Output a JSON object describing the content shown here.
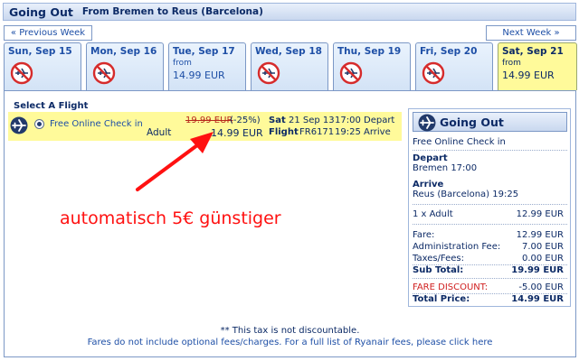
{
  "header": {
    "title": "Going Out",
    "route": "From Bremen to Reus (Barcelona)"
  },
  "nav": {
    "prev_week": "« Previous Week",
    "next_week": "Next Week »"
  },
  "days": [
    {
      "label": "Sun, Sep 15",
      "available": false,
      "from": "",
      "price": ""
    },
    {
      "label": "Mon, Sep 16",
      "available": false,
      "from": "",
      "price": ""
    },
    {
      "label": "Tue, Sep 17",
      "available": true,
      "from": "from",
      "price": "14.99 EUR"
    },
    {
      "label": "Wed, Sep 18",
      "available": false,
      "from": "",
      "price": ""
    },
    {
      "label": "Thu, Sep 19",
      "available": false,
      "from": "",
      "price": ""
    },
    {
      "label": "Fri, Sep 20",
      "available": false,
      "from": "",
      "price": ""
    },
    {
      "label": "Sat, Sep 21",
      "available": true,
      "selected": true,
      "from": "from",
      "price": "14.99 EUR"
    }
  ],
  "select_title": "Select A Flight",
  "flight": {
    "checkin": "Free Online Check in",
    "passenger": "Adult",
    "old_price": "19.99 EUR",
    "discount": "(-25%)",
    "new_price": "14.99 EUR",
    "day": "Sat",
    "date": "21 Sep 13",
    "depart_time": "17:00 Depart",
    "flight_label": "Flight",
    "flight_no": "FR6171",
    "arrive_time": "19:25 Arrive"
  },
  "annotation": "automatisch 5€ günstiger",
  "summary": {
    "title": "Going Out",
    "checkin": "Free Online Check in",
    "depart_label": "Depart",
    "depart_value": "Bremen 17:00",
    "arrive_label": "Arrive",
    "arrive_value": "Reus (Barcelona) 19:25",
    "passenger_line": {
      "label": "1 x Adult",
      "value": "12.99 EUR"
    },
    "fare": {
      "label": "Fare:",
      "value": "12.99 EUR"
    },
    "admin_fee": {
      "label": "Administration Fee:",
      "value": "7.00 EUR"
    },
    "taxes": {
      "label": "Taxes/Fees:",
      "value": "0.00 EUR"
    },
    "subtotal": {
      "label": "Sub Total:",
      "value": "19.99 EUR"
    },
    "fare_discount": {
      "label": "FARE DISCOUNT:",
      "value": "-5.00 EUR"
    },
    "total": {
      "label": "Total Price:",
      "value": "14.99 EUR"
    }
  },
  "footer": {
    "tax_note": "** This tax is not discountable.",
    "fees_note": "Fares do not include optional fees/charges. For a full list of Ryanair fees, please click here"
  },
  "colors": {
    "accent": "#1e4fa6",
    "highlight": "#fffa9a",
    "annotation": "#ff1111",
    "discount_red": "#d02020"
  }
}
